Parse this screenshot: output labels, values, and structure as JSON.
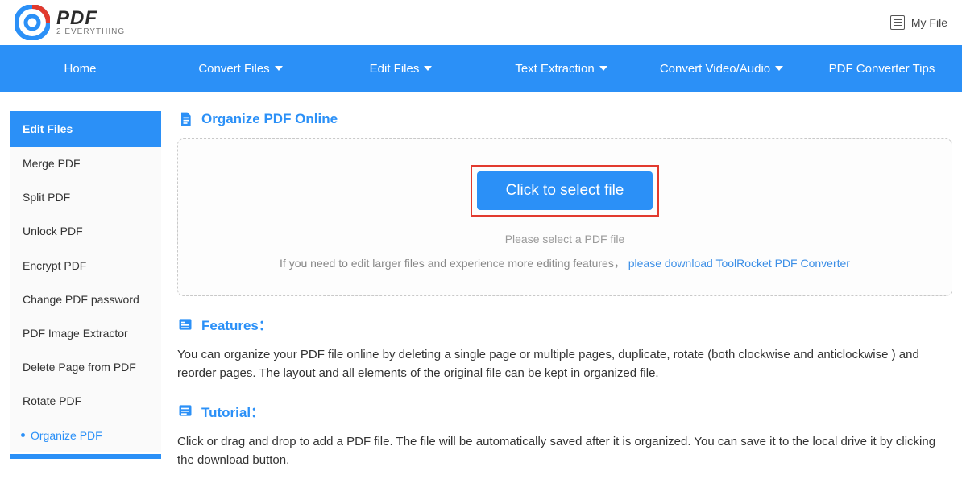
{
  "header": {
    "logo_main": "PDF",
    "logo_sub": "2 EVERYTHING",
    "my_file": "My File"
  },
  "nav": {
    "items": [
      {
        "label": "Home",
        "dropdown": false
      },
      {
        "label": "Convert Files",
        "dropdown": true
      },
      {
        "label": "Edit Files",
        "dropdown": true
      },
      {
        "label": "Text Extraction",
        "dropdown": true
      },
      {
        "label": "Convert Video/Audio",
        "dropdown": true
      },
      {
        "label": "PDF Converter Tips",
        "dropdown": false
      }
    ]
  },
  "sidebar": {
    "title": "Edit Files",
    "items": [
      {
        "label": "Merge PDF",
        "active": false
      },
      {
        "label": "Split PDF",
        "active": false
      },
      {
        "label": "Unlock PDF",
        "active": false
      },
      {
        "label": "Encrypt PDF",
        "active": false
      },
      {
        "label": "Change PDF password",
        "active": false
      },
      {
        "label": "PDF Image Extractor",
        "active": false
      },
      {
        "label": "Delete Page from PDF",
        "active": false
      },
      {
        "label": "Rotate PDF",
        "active": false
      },
      {
        "label": "Organize PDF",
        "active": true
      }
    ]
  },
  "page": {
    "title": "Organize PDF Online",
    "select_button": "Click to select file",
    "select_hint": "Please select a PDF file",
    "note_prefix": "If you need to edit larger files and experience more editing features，",
    "note_link": "please download ToolRocket PDF Converter",
    "features_heading": "Features：",
    "features_body": "You can organize your PDF file online by deleting a single page or multiple pages, duplicate, rotate (both clockwise and anticlockwise ) and reorder pages. The layout and all elements of the original file can be kept in organized file.",
    "tutorial_heading": "Tutorial：",
    "tutorial_body": "Click or drag and drop to add a PDF file. The file will be automatically saved after it is organized. You can save it to the local drive it by clicking the download button."
  }
}
